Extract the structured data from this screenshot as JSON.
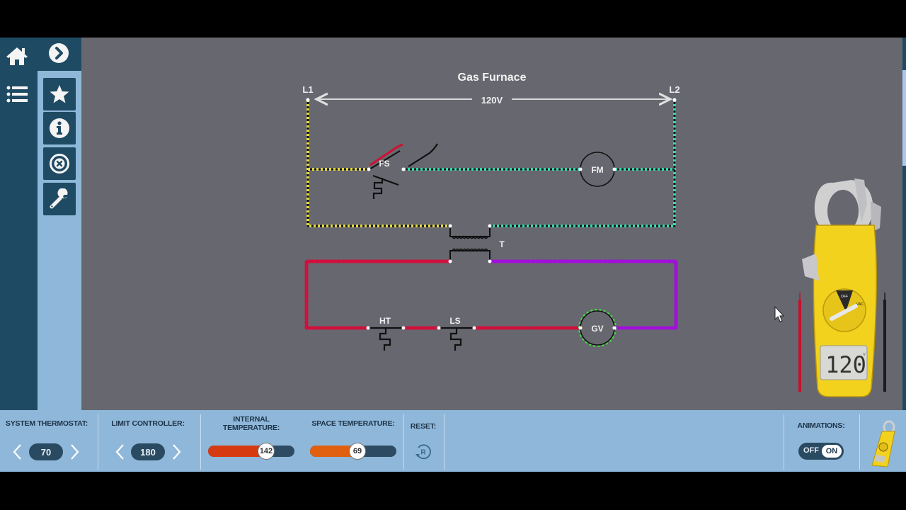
{
  "sidebar": {
    "home_icon": "home-icon",
    "list_icon": "list-icon",
    "next_icon": "chevron-right-circle-icon",
    "tools": [
      {
        "name": "favorite",
        "icon": "star-icon"
      },
      {
        "name": "info",
        "icon": "info-icon"
      },
      {
        "name": "close",
        "icon": "close-circle-icon"
      },
      {
        "name": "tools",
        "icon": "wrench-icon"
      }
    ]
  },
  "diagram": {
    "title": "Gas Furnace",
    "voltage_label": "120V",
    "line1": "L1",
    "line2": "L2",
    "components": {
      "fan_switch": "FS",
      "fan_motor": "FM",
      "transformer": "T",
      "heat_thermostat": "HT",
      "limit_switch": "LS",
      "gas_valve": "GV"
    },
    "colors": {
      "l1_wire": "#e6dc3c",
      "l2_wire": "#2ee0b0",
      "secondary_left": "#d0103c",
      "secondary_right": "#a010d8",
      "gas_valve_active": "#40e040",
      "probe_red": "#d01030"
    }
  },
  "meter": {
    "display_value": "120",
    "unit": "V",
    "dial_labels": [
      "OFF",
      "VAC"
    ]
  },
  "controls": {
    "system_thermostat": {
      "label": "SYSTEM THERMOSTAT:",
      "value": "70"
    },
    "limit_controller": {
      "label": "LIMIT CONTROLLER:",
      "value": "180"
    },
    "internal_temperature": {
      "label_line1": "INTERNAL",
      "label_line2": "TEMPERATURE:",
      "value": "142",
      "fraction": 0.67,
      "color": "#d63a10"
    },
    "space_temperature": {
      "label": "SPACE TEMPERATURE:",
      "value": "69",
      "fraction": 0.55,
      "color": "#e0600f"
    },
    "reset": {
      "label": "RESET:",
      "icon": "reset-icon"
    },
    "animations": {
      "label": "ANIMATIONS:",
      "off_label": "OFF",
      "on_label": "ON",
      "state": "ON"
    },
    "meter_thumbnail_icon": "clamp-meter-icon"
  }
}
